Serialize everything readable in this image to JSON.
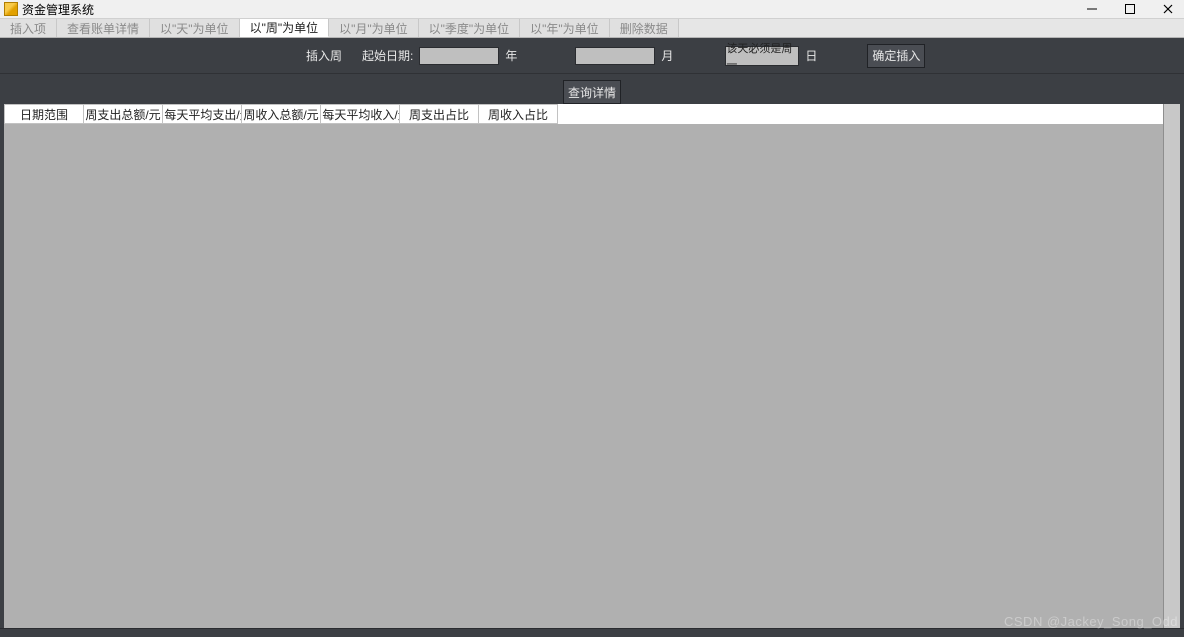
{
  "window": {
    "title": "资金管理系统"
  },
  "tabs": [
    {
      "label": "插入项",
      "active": false
    },
    {
      "label": "查看账单详情",
      "active": false
    },
    {
      "label": "以\"天\"为单位",
      "active": false
    },
    {
      "label": "以\"周\"为单位",
      "active": true
    },
    {
      "label": "以\"月\"为单位",
      "active": false
    },
    {
      "label": "以\"季度\"为单位",
      "active": false
    },
    {
      "label": "以\"年\"为单位",
      "active": false
    },
    {
      "label": "删除数据",
      "active": false
    }
  ],
  "toolbar": {
    "insert_week_label": "插入周",
    "start_date_label": "起始日期:",
    "year_suffix": "年",
    "month_suffix": "月",
    "day_suffix": "日",
    "monday_hint": "该天必须是周一",
    "confirm_label": "确定插入",
    "year_value": "",
    "month_value": ""
  },
  "subbar": {
    "query_label": "查询详情"
  },
  "table": {
    "columns": [
      {
        "label": "日期范围",
        "width": 78
      },
      {
        "label": "周支出总额/元",
        "width": 78
      },
      {
        "label": "周每天平均支出/元",
        "width": 78
      },
      {
        "label": "周收入总额/元",
        "width": 78
      },
      {
        "label": "周每天平均收入/元",
        "width": 78
      },
      {
        "label": "周支出占比",
        "width": 78
      },
      {
        "label": "周收入占比",
        "width": 78
      }
    ],
    "rows": []
  },
  "watermark": "CSDN @Jackey_Song_Odd"
}
